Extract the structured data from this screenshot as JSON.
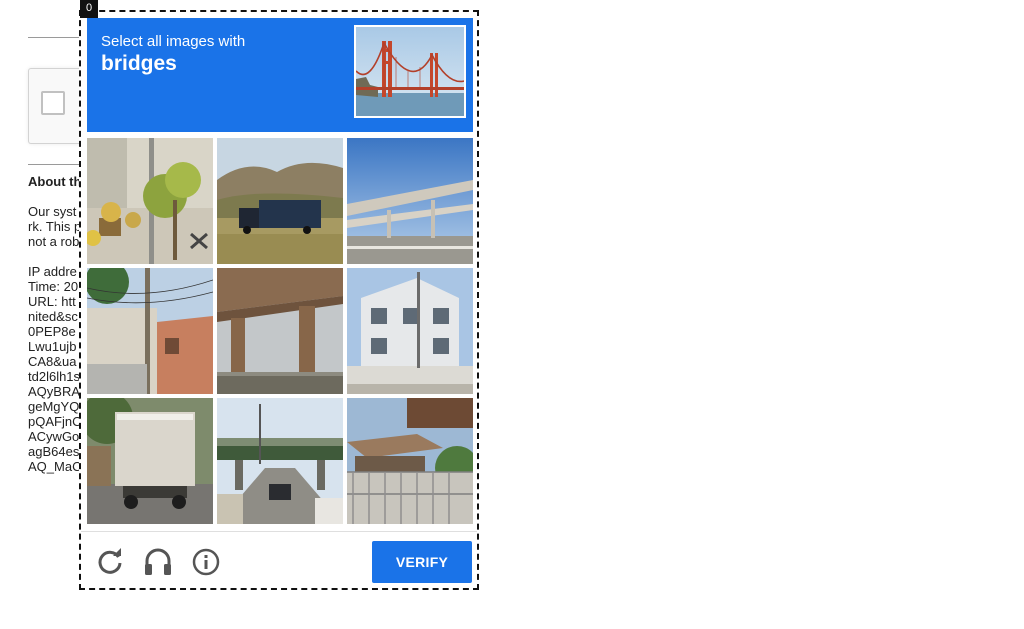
{
  "background_page": {
    "about_title": "About th",
    "lines_group1": [
      "Our syst",
      "rk. This p",
      "not a rob"
    ],
    "lines_group2": [
      "IP addre",
      "Time: 20",
      "URL: htt",
      "nited&sc",
      "0PEP8e",
      "Lwu1ujb",
      "CA8&ua",
      "td2l6lh1s",
      "AQyBRA",
      "geMgYQ",
      "pQAFjnC",
      "ACywGo",
      "agB64es",
      "AQ_MaC"
    ]
  },
  "frame": {
    "tag": "0"
  },
  "challenge": {
    "prompt": "Select all images with",
    "keyword": "bridges",
    "sample_icon": "golden-gate-bridge-photo"
  },
  "tiles": [
    {
      "scene": "street-sidewalk-with-pole-and-plants"
    },
    {
      "scene": "truck-on-grassy-plain-with-mountains"
    },
    {
      "scene": "highway-overpass-under-blue-sky"
    },
    {
      "scene": "houses-with-utility-pole-and-wires"
    },
    {
      "scene": "underside-of-concrete-bridge"
    },
    {
      "scene": "white-apartment-building"
    },
    {
      "scene": "truck-rear-on-street"
    },
    {
      "scene": "road-under-green-overpass-bridge"
    },
    {
      "scene": "house-with-fence-and-trees"
    }
  ],
  "footer": {
    "reload_icon": "reload-icon",
    "audio_icon": "headphones-icon",
    "info_icon": "info-icon",
    "verify_label": "VERIFY"
  },
  "colors": {
    "accent": "#1a73e8",
    "frame_border": "#111111"
  }
}
